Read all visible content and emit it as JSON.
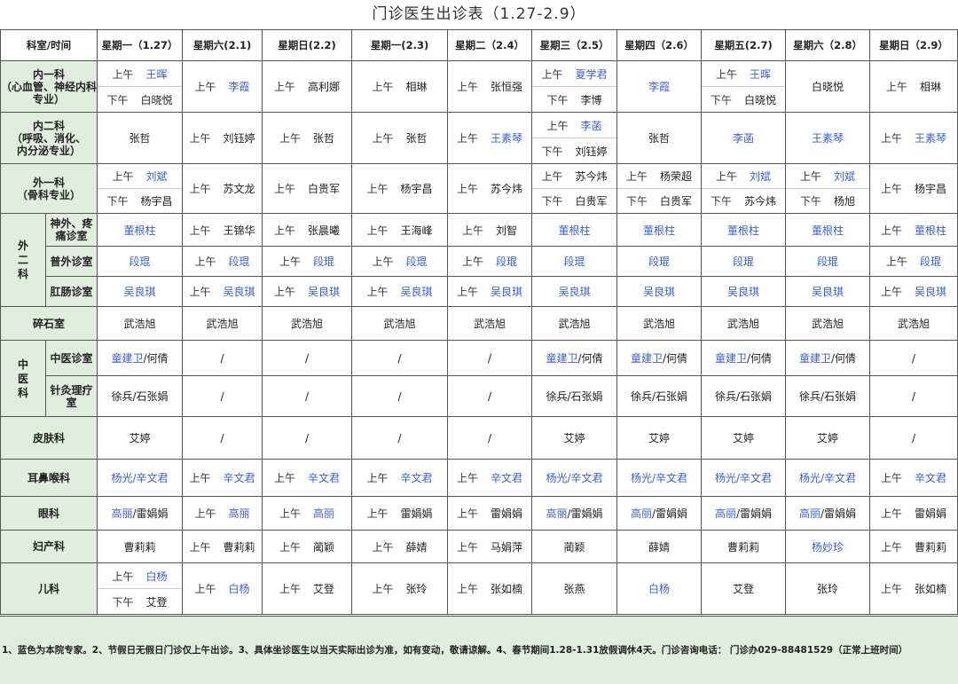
{
  "title": "门诊医生出诊表（1.27-2.9）",
  "header_corner": "科室/时间",
  "days": [
    "星期一（1.27）",
    "星期六(2.1)",
    "星期日(2.2)",
    "星期一(2.3)",
    "星期二（2.4）",
    "星期三（2.5）",
    "星期四（2.6）",
    "星期五(2.7)",
    "星期六（2.8）",
    "星期日（2.9）"
  ],
  "rows": [
    {
      "dept": "内一科\n（心血管、神经内科专业）",
      "cells": [
        [
          [
            "上午",
            "王晖",
            1
          ],
          [
            "下午",
            "白晓悦",
            0
          ]
        ],
        [
          [
            "上午",
            "李霞",
            1
          ]
        ],
        [
          [
            "上午",
            "高利娜",
            0
          ]
        ],
        [
          [
            "上午",
            "相琳",
            0
          ]
        ],
        [
          [
            "上午",
            "张恒强",
            0
          ]
        ],
        [
          [
            "上午",
            "夏学君",
            1
          ],
          [
            "下午",
            "李博",
            0
          ]
        ],
        [
          [
            "",
            "李霞",
            1
          ]
        ],
        [
          [
            "上午",
            "王晖",
            1
          ],
          [
            "下午",
            "白晓悦",
            0
          ]
        ],
        [
          [
            "",
            "白晓悦",
            0
          ]
        ],
        [
          [
            "上午",
            "相琳",
            0
          ]
        ]
      ]
    },
    {
      "dept": "内二科\n（呼吸、消化、\n内分泌专业）",
      "cells": [
        [
          [
            "",
            "张哲",
            0
          ]
        ],
        [
          [
            "上午",
            "刘钰婷",
            0
          ]
        ],
        [
          [
            "上午",
            "张哲",
            0
          ]
        ],
        [
          [
            "上午",
            "张哲",
            0
          ]
        ],
        [
          [
            "上午",
            "王素琴",
            1
          ]
        ],
        [
          [
            "上午",
            "李菡",
            1
          ],
          [
            "下午",
            "刘钰婷",
            0
          ]
        ],
        [
          [
            "",
            "张哲",
            0
          ]
        ],
        [
          [
            "",
            "李菡",
            1
          ]
        ],
        [
          [
            "",
            "王素琴",
            1
          ]
        ],
        [
          [
            "上午",
            "王素琴",
            1
          ]
        ]
      ]
    },
    {
      "dept": "外一科\n（骨科专业）",
      "cells": [
        [
          [
            "上午",
            "刘斌",
            1
          ],
          [
            "下午",
            "杨宇昌",
            0
          ]
        ],
        [
          [
            "上午",
            "苏文龙",
            0
          ]
        ],
        [
          [
            "上午",
            "白贵军",
            0
          ]
        ],
        [
          [
            "上午",
            "杨宇昌",
            0
          ]
        ],
        [
          [
            "上午",
            "苏今炜",
            0
          ]
        ],
        [
          [
            "上午",
            "苏今炜",
            0
          ],
          [
            "下午",
            "白贵军",
            0
          ]
        ],
        [
          [
            "上午",
            "杨荣超",
            0
          ],
          [
            "下午",
            "白贵军",
            0
          ]
        ],
        [
          [
            "上午",
            "刘斌",
            1
          ],
          [
            "下午",
            "苏今炜",
            0
          ]
        ],
        [
          [
            "上午",
            "刘斌",
            1
          ],
          [
            "下午",
            "杨旭",
            0
          ]
        ],
        [
          [
            "上午",
            "杨宇昌",
            0
          ]
        ]
      ]
    },
    {
      "group": "外\n二\n科",
      "sub": "神外、疼\n痛诊室",
      "cells": [
        [
          [
            "",
            "董根柱",
            1
          ]
        ],
        [
          [
            "上午",
            "王锦华",
            0
          ]
        ],
        [
          [
            "上午",
            "张晨曦",
            0
          ]
        ],
        [
          [
            "上午",
            "王海峰",
            0
          ]
        ],
        [
          [
            "上午",
            "刘智",
            0
          ]
        ],
        [
          [
            "",
            "董根柱",
            1
          ]
        ],
        [
          [
            "",
            "董根柱",
            1
          ]
        ],
        [
          [
            "",
            "董根柱",
            1
          ]
        ],
        [
          [
            "",
            "董根柱",
            1
          ]
        ],
        [
          [
            "上午",
            "董根柱",
            1
          ]
        ]
      ]
    },
    {
      "sub": "普外诊室",
      "cells": [
        [
          [
            "",
            "段琨",
            1
          ]
        ],
        [
          [
            "上午",
            "段琨",
            1
          ]
        ],
        [
          [
            "上午",
            "段琨",
            1
          ]
        ],
        [
          [
            "上午",
            "段琨",
            1
          ]
        ],
        [
          [
            "上午",
            "段琨",
            1
          ]
        ],
        [
          [
            "",
            "段琨",
            1
          ]
        ],
        [
          [
            "",
            "段琨",
            1
          ]
        ],
        [
          [
            "",
            "段琨",
            1
          ]
        ],
        [
          [
            "",
            "段琨",
            1
          ]
        ],
        [
          [
            "上午",
            "段琨",
            1
          ]
        ]
      ]
    },
    {
      "sub": "肛肠诊室",
      "cells": [
        [
          [
            "",
            "吴良琪",
            1
          ]
        ],
        [
          [
            "上午",
            "吴良琪",
            1
          ]
        ],
        [
          [
            "上午",
            "吴良琪",
            1
          ]
        ],
        [
          [
            "上午",
            "吴良琪",
            1
          ]
        ],
        [
          [
            "上午",
            "吴良琪",
            1
          ]
        ],
        [
          [
            "",
            "吴良琪",
            1
          ]
        ],
        [
          [
            "",
            "吴良琪",
            1
          ]
        ],
        [
          [
            "",
            "吴良琪",
            1
          ]
        ],
        [
          [
            "",
            "吴良琪",
            1
          ]
        ],
        [
          [
            "上午",
            "吴良琪",
            1
          ]
        ]
      ]
    },
    {
      "dept": "碎石室",
      "cells": [
        [
          [
            "",
            "武浩旭",
            0
          ]
        ],
        [
          [
            "",
            "武浩旭",
            0
          ]
        ],
        [
          [
            "",
            "武浩旭",
            0
          ]
        ],
        [
          [
            "",
            "武浩旭",
            0
          ]
        ],
        [
          [
            "",
            "武浩旭",
            0
          ]
        ],
        [
          [
            "",
            "武浩旭",
            0
          ]
        ],
        [
          [
            "",
            "武浩旭",
            0
          ]
        ],
        [
          [
            "",
            "武浩旭",
            0
          ]
        ],
        [
          [
            "",
            "武浩旭",
            0
          ]
        ],
        [
          [
            "",
            "武浩旭",
            0
          ]
        ]
      ]
    },
    {
      "group": "中\n医\n科",
      "sub": "中医诊室",
      "cells": [
        [
          [
            "",
            "童建卫/何倩",
            2
          ]
        ],
        [
          [
            "",
            "/",
            0
          ]
        ],
        [
          [
            "",
            "/",
            0
          ]
        ],
        [
          [
            "",
            "/",
            0
          ]
        ],
        [
          [
            "",
            "/",
            0
          ]
        ],
        [
          [
            "",
            "童建卫/何倩",
            2
          ]
        ],
        [
          [
            "",
            "童建卫/何倩",
            2
          ]
        ],
        [
          [
            "",
            "童建卫/何倩",
            2
          ]
        ],
        [
          [
            "",
            "童建卫/何倩",
            2
          ]
        ],
        [
          [
            "",
            "/",
            0
          ]
        ]
      ]
    },
    {
      "sub": "针灸理疗\n室",
      "cells": [
        [
          [
            "",
            "徐兵/石张娟",
            0
          ]
        ],
        [
          [
            "",
            "/",
            0
          ]
        ],
        [
          [
            "",
            "/",
            0
          ]
        ],
        [
          [
            "",
            "/",
            0
          ]
        ],
        [
          [
            "",
            "/",
            0
          ]
        ],
        [
          [
            "",
            "徐兵/石张娟",
            0
          ]
        ],
        [
          [
            "",
            "徐兵/石张娟",
            0
          ]
        ],
        [
          [
            "",
            "徐兵/石张娟",
            0
          ]
        ],
        [
          [
            "",
            "徐兵/石张娟",
            0
          ]
        ],
        [
          [
            "",
            "/",
            0
          ]
        ]
      ]
    },
    {
      "dept": "皮肤科",
      "cells": [
        [
          [
            "",
            "艾婷",
            0
          ]
        ],
        [
          [
            "",
            "/",
            0
          ]
        ],
        [
          [
            "",
            "/",
            0
          ]
        ],
        [
          [
            "",
            "/",
            0
          ]
        ],
        [
          [
            "",
            "/",
            0
          ]
        ],
        [
          [
            "",
            "艾婷",
            0
          ]
        ],
        [
          [
            "",
            "艾婷",
            0
          ]
        ],
        [
          [
            "",
            "艾婷",
            0
          ]
        ],
        [
          [
            "",
            "艾婷",
            0
          ]
        ],
        [
          [
            "",
            "/",
            0
          ]
        ]
      ]
    },
    {
      "dept": "耳鼻喉科",
      "cells": [
        [
          [
            "",
            "杨光/辛文君",
            1
          ]
        ],
        [
          [
            "上午",
            "辛文君",
            1
          ]
        ],
        [
          [
            "上午",
            "辛文君",
            1
          ]
        ],
        [
          [
            "上午",
            "辛文君",
            1
          ]
        ],
        [
          [
            "上午",
            "辛文君",
            1
          ]
        ],
        [
          [
            "",
            "杨光/辛文君",
            1
          ]
        ],
        [
          [
            "",
            "杨光/辛文君",
            1
          ]
        ],
        [
          [
            "",
            "杨光/辛文君",
            1
          ]
        ],
        [
          [
            "",
            "杨光/辛文君",
            1
          ]
        ],
        [
          [
            "上午",
            "辛文君",
            1
          ]
        ]
      ]
    },
    {
      "dept": "眼科",
      "cells": [
        [
          [
            "",
            "高丽/雷娟娟",
            2
          ]
        ],
        [
          [
            "上午",
            "高丽",
            1
          ]
        ],
        [
          [
            "上午",
            "高丽",
            1
          ]
        ],
        [
          [
            "上午",
            "雷娟娟",
            0
          ]
        ],
        [
          [
            "上午",
            "雷娟娟",
            0
          ]
        ],
        [
          [
            "",
            "高丽/雷娟娟",
            2
          ]
        ],
        [
          [
            "",
            "高丽/雷娟娟",
            2
          ]
        ],
        [
          [
            "",
            "高丽/雷娟娟",
            2
          ]
        ],
        [
          [
            "",
            "高丽/雷娟娟",
            2
          ]
        ],
        [
          [
            "上午",
            "雷娟娟",
            0
          ]
        ]
      ]
    },
    {
      "dept": "妇产科",
      "cells": [
        [
          [
            "",
            "曹莉莉",
            0
          ]
        ],
        [
          [
            "上午",
            "曹莉莉",
            0
          ]
        ],
        [
          [
            "上午",
            "蔺颖",
            0
          ]
        ],
        [
          [
            "上午",
            "薛婧",
            0
          ]
        ],
        [
          [
            "上午",
            "马娟萍",
            0
          ]
        ],
        [
          [
            "",
            "蔺颖",
            0
          ]
        ],
        [
          [
            "",
            "薛婧",
            0
          ]
        ],
        [
          [
            "",
            "曹莉莉",
            0
          ]
        ],
        [
          [
            "",
            "杨妙珍",
            1
          ]
        ],
        [
          [
            "上午",
            "曹莉莉",
            0
          ]
        ]
      ]
    },
    {
      "dept": "儿科",
      "cells": [
        [
          [
            "上午",
            "白杨",
            1
          ],
          [
            "下午",
            "艾登",
            0
          ]
        ],
        [
          [
            "上午",
            "白杨",
            1
          ]
        ],
        [
          [
            "上午",
            "艾登",
            0
          ]
        ],
        [
          [
            "上午",
            "张玲",
            0
          ]
        ],
        [
          [
            "上午",
            "张如楠",
            0
          ]
        ],
        [
          [
            "",
            "张燕",
            0
          ]
        ],
        [
          [
            "",
            "白杨",
            1
          ]
        ],
        [
          [
            "",
            "艾登",
            0
          ]
        ],
        [
          [
            "",
            "张玲",
            0
          ]
        ],
        [
          [
            "上午",
            "张如楠",
            0
          ]
        ]
      ]
    }
  ],
  "footer": "1、蓝色为本院专家。2、节假日无假日门诊仅上午出诊。3、具体坐诊医生以当天实际出诊为准，如有变动，敬请谅解。4、春节期间1.28-1.31放假调休4天。门诊咨询电话： 门诊办029-88481529（正常上班时间）"
}
